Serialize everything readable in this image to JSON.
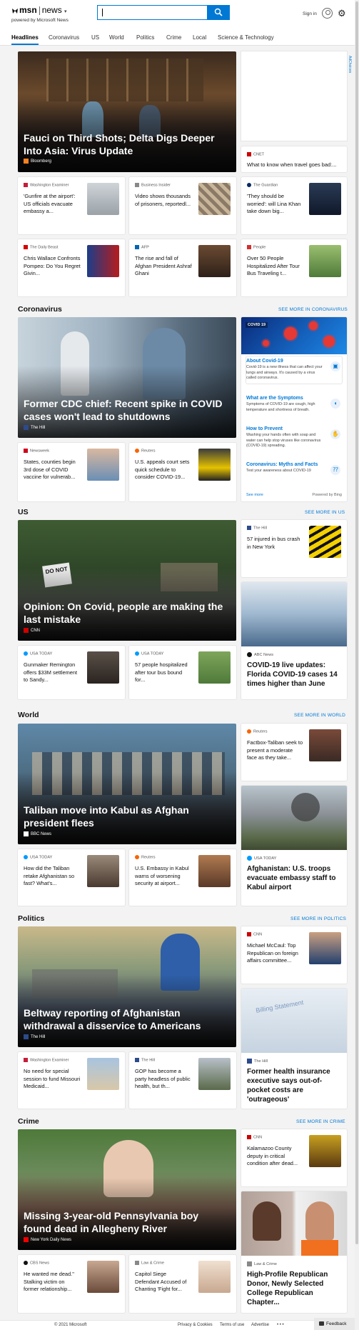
{
  "header": {
    "brand": "msn",
    "section": "news",
    "powered_by": "powered by Microsoft News",
    "search_placeholder": "",
    "sign_in": "Sign in",
    "accent": "#0078d4"
  },
  "nav": {
    "items": [
      "Headlines",
      "Coronavirus",
      "US",
      "World",
      "Politics",
      "Crime",
      "Local",
      "Science & Technology"
    ],
    "active": "Headlines"
  },
  "ad_label": "AdChoices",
  "headlines": {
    "hero": {
      "title": "Fauci on Third Shots; Delta Digs Deeper Into Asia: Virus Update",
      "source": "Bloomberg"
    },
    "side": {
      "source": "CNET",
      "title": "What to know when travel goes bad:..."
    },
    "row1": [
      {
        "source": "Washington Examiner",
        "title": "'Gunfire at the airport': US officials evacuate embassy a..."
      },
      {
        "source": "Business Insider",
        "title": "Video shows thousands of prisoners, reportedl..."
      },
      {
        "source": "The Guardian",
        "title": "'They should be worried': will Lina Khan take down big..."
      }
    ],
    "row2": [
      {
        "source": "The Daily Beast",
        "title": "Chris Wallace Confronts Pompeo: Do You Regret Givin..."
      },
      {
        "source": "AFP",
        "title": "The rise and fall of Afghan President Ashraf Ghani"
      },
      {
        "source": "People",
        "title": "Over 50 People Hospitalized After Tour Bus Traveling t..."
      }
    ]
  },
  "coronavirus": {
    "title": "Coronavirus",
    "see_more": "SEE MORE IN CORONAVIRUS",
    "hero": {
      "title": "Former CDC chief: Recent spike in COVID cases won't lead to shutdowns",
      "source": "The Hill"
    },
    "cards": [
      {
        "source": "Newsweek",
        "title": "States, counties begin 3rd dose of COVID vaccine for vulnerab..."
      },
      {
        "source": "Reuters",
        "title": "U.S. appeals court sets quick schedule to consider COVID-19..."
      }
    ],
    "widget": {
      "badge": "COVID 19",
      "items": [
        {
          "heading": "About Covid-19",
          "desc": "Covid-19 is a new illness that can affect your lungs and airways. It's caused by a virus called coronavirus."
        },
        {
          "heading": "What are the Symptoms",
          "desc": "Symptoms of COVID-19 are cough, high temperature and shortness of breath."
        },
        {
          "heading": "How to Prevent",
          "desc": "Washing your hands often with soap and water can help stop viruses like coronavirus (COVID-19) spreading."
        },
        {
          "heading": "Coronavirus: Myths and Facts",
          "desc": "Test your awareness about COVID-19"
        }
      ],
      "see_more": "See more",
      "powered": "Powered by Bing"
    }
  },
  "us": {
    "title": "US",
    "see_more": "SEE MORE IN US",
    "hero": {
      "title": "Opinion: On Covid, people are making the last mistake",
      "source": "CNN"
    },
    "side": {
      "source": "The Hill",
      "title": "57 injured in bus crash in New York"
    },
    "tall": {
      "source": "ABC News",
      "title": "COVID-19 live updates: Florida COVID-19 cases 14 times higher than June"
    },
    "cards": [
      {
        "source": "USA TODAY",
        "title": "Gunmaker Remington offers $33M settlement to Sandy..."
      },
      {
        "source": "USA TODAY",
        "title": "57 people hospitalized after tour bus bound for..."
      }
    ],
    "sign_text": "DO NOT"
  },
  "world": {
    "title": "World",
    "see_more": "SEE MORE IN WORLD",
    "hero": {
      "title": "Taliban move into Kabul as Afghan president flees",
      "source": "BBC News"
    },
    "side": {
      "source": "Reuters",
      "title": "Factbox-Taliban seek to present a moderate face as they take..."
    },
    "tall": {
      "source": "USA TODAY",
      "title": "Afghanistan: U.S. troops evacuate embassy staff to Kabul airport"
    },
    "cards": [
      {
        "source": "USA TODAY",
        "title": "How did the Taliban retake Afghanistan so fast? What's..."
      },
      {
        "source": "Reuters",
        "title": "U.S. Embassy in Kabul warns of worsening security at airport..."
      }
    ]
  },
  "politics": {
    "title": "Politics",
    "see_more": "SEE MORE IN POLITICS",
    "hero": {
      "title": "Beltway reporting of Afghanistan withdrawal a disservice to Americans",
      "source": "The Hill"
    },
    "side": {
      "source": "CNN",
      "title": "Michael McCaul: Top Republican on foreign affairs committee..."
    },
    "tall": {
      "source": "The Hill",
      "title": "Former health insurance executive says out-of-pocket costs are 'outrageous'"
    },
    "cards": [
      {
        "source": "Washington Examiner",
        "title": "No need for special session to fund Missouri Medicaid..."
      },
      {
        "source": "The Hill",
        "title": "GOP has become a party headless of public health, but th..."
      }
    ],
    "doc_text": "Billing Statement"
  },
  "crime": {
    "title": "Crime",
    "see_more": "SEE MORE IN CRIME",
    "hero": {
      "title": "Missing 3-year-old Pennsylvania boy found dead in Allegheny River",
      "source": "New York Daily News"
    },
    "side": {
      "source": "CNN",
      "title": "Kalamazoo County deputy in critical condition after dead..."
    },
    "tall": {
      "source": "Law & Crime",
      "title": "High-Profile Republican Donor, Newly Selected College Republican Chapter..."
    },
    "cards": [
      {
        "source": "CBS News",
        "title": "He wanted me dead.\" Stalking victim on former relationship..."
      },
      {
        "source": "Law & Crime",
        "title": "Capitol Siege Defendant Accused of Chanting 'Fight for..."
      }
    ]
  },
  "footer": {
    "copyright": "© 2021 Microsoft",
    "links": [
      "Privacy & Cookies",
      "Terms of use",
      "Advertise"
    ],
    "more": "• • •",
    "feedback": "Feedback"
  }
}
